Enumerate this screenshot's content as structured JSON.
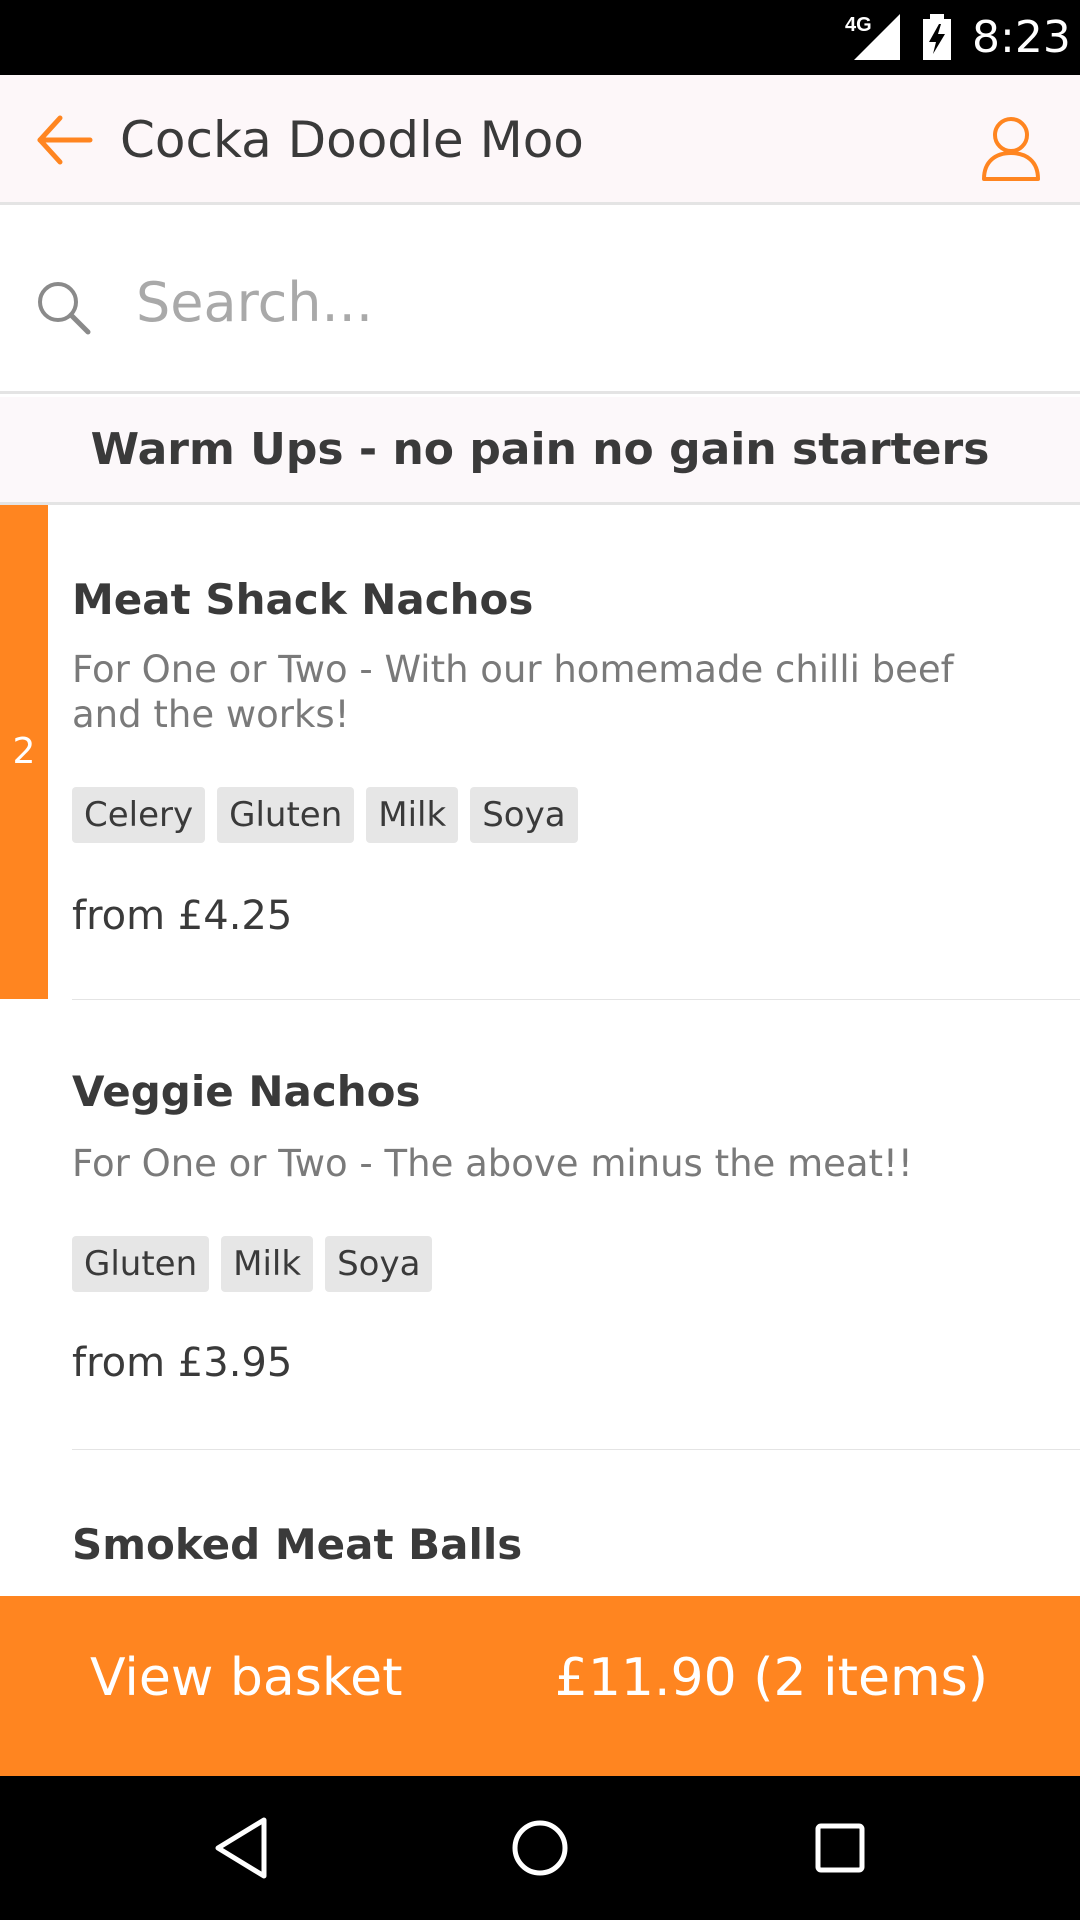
{
  "status_bar": {
    "network": "4G",
    "time": "8:23"
  },
  "app_bar": {
    "title": "Cocka Doodle Moo",
    "back_icon": "arrow-left-icon",
    "account_icon": "user-icon",
    "accent_color": "#ff8520"
  },
  "search": {
    "placeholder": "Search...",
    "value": ""
  },
  "section": {
    "title": "Warm Ups - no pain no gain starters"
  },
  "items": [
    {
      "name": "Meat Shack Nachos",
      "description": "For One or Two - With our homemade chilli beef and the works!",
      "allergens": [
        "Celery",
        "Gluten",
        "Milk",
        "Soya"
      ],
      "price": "from £4.25",
      "quantity_in_basket": "2"
    },
    {
      "name": "Veggie Nachos",
      "description": "For One or Two - The above minus the meat!!",
      "allergens": [
        "Gluten",
        "Milk",
        "Soya"
      ],
      "price": "from £3.95"
    },
    {
      "name": "Smoked Meat Balls"
    }
  ],
  "basket": {
    "label": "View basket",
    "total": "£11.90 (2 items)",
    "color": "#ff8520"
  },
  "nav": {
    "back_icon": "triangle-back-icon",
    "home_icon": "circle-home-icon",
    "recents_icon": "square-recents-icon"
  }
}
